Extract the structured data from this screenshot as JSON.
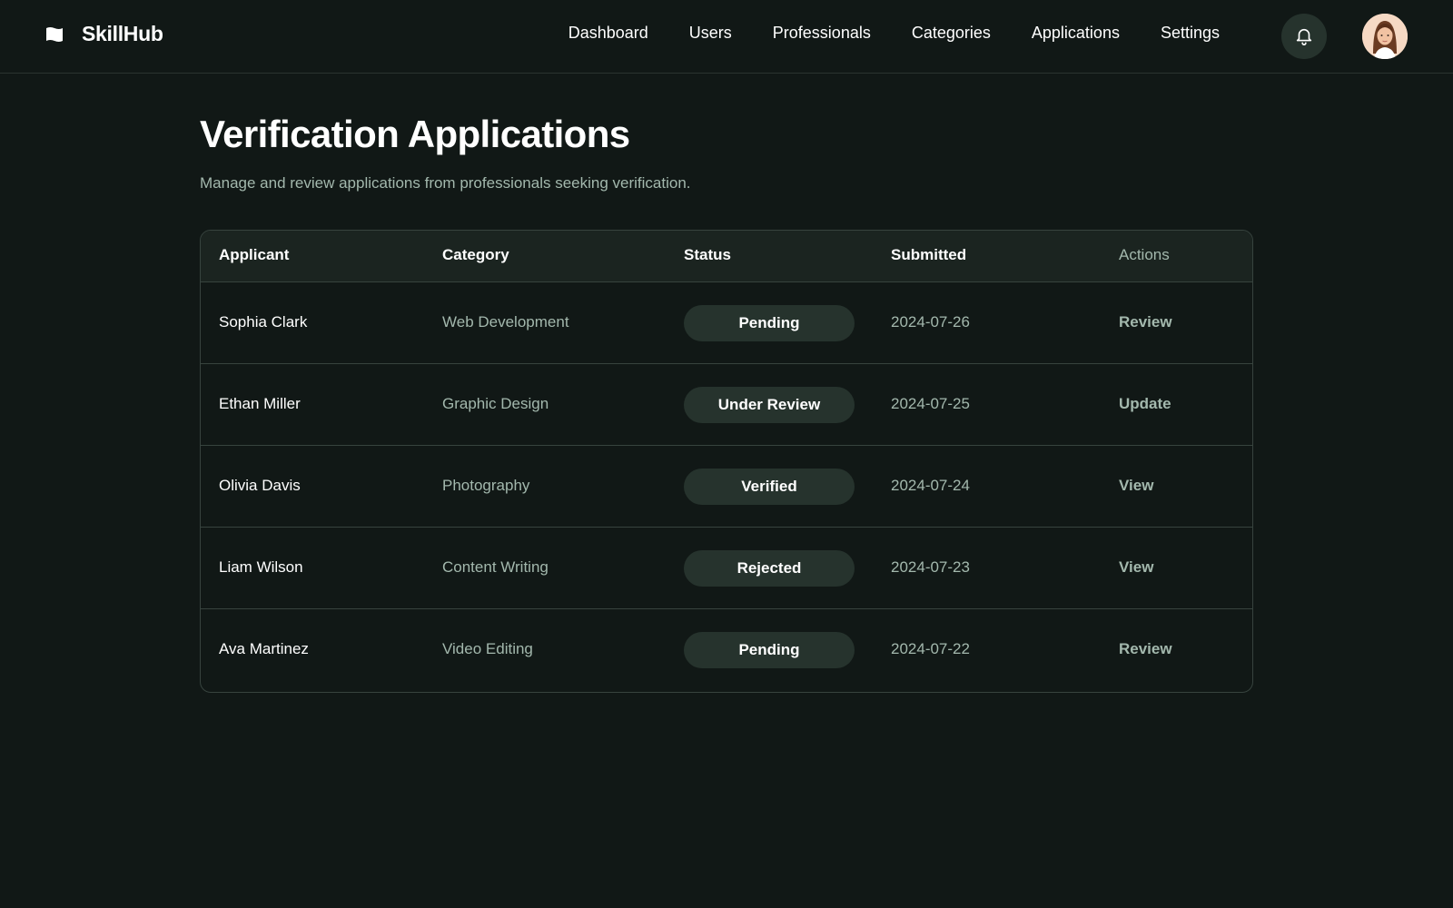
{
  "header": {
    "brand": "SkillHub",
    "nav": [
      "Dashboard",
      "Users",
      "Professionals",
      "Categories",
      "Applications",
      "Settings"
    ]
  },
  "page": {
    "title": "Verification Applications",
    "subtitle": "Manage and review applications from professionals seeking verification."
  },
  "table": {
    "columns": [
      "Applicant",
      "Category",
      "Status",
      "Submitted",
      "Actions"
    ],
    "rows": [
      {
        "applicant": "Sophia Clark",
        "category": "Web Development",
        "status": "Pending",
        "submitted": "2024-07-26",
        "action": "Review"
      },
      {
        "applicant": "Ethan Miller",
        "category": "Graphic Design",
        "status": "Under Review",
        "submitted": "2024-07-25",
        "action": "Update"
      },
      {
        "applicant": "Olivia Davis",
        "category": "Photography",
        "status": "Verified",
        "submitted": "2024-07-24",
        "action": "View"
      },
      {
        "applicant": "Liam Wilson",
        "category": "Content Writing",
        "status": "Rejected",
        "submitted": "2024-07-23",
        "action": "View"
      },
      {
        "applicant": "Ava Martinez",
        "category": "Video Editing",
        "status": "Pending",
        "submitted": "2024-07-22",
        "action": "Review"
      }
    ]
  },
  "icons": {
    "brand": "flag-icon",
    "notifications": "bell-icon",
    "avatar": "user-avatar"
  },
  "colors": {
    "background": "#111816",
    "surface": "#1b2420",
    "badge": "#26332d",
    "muted_text": "#a3b8ad",
    "border": "#37433e"
  }
}
